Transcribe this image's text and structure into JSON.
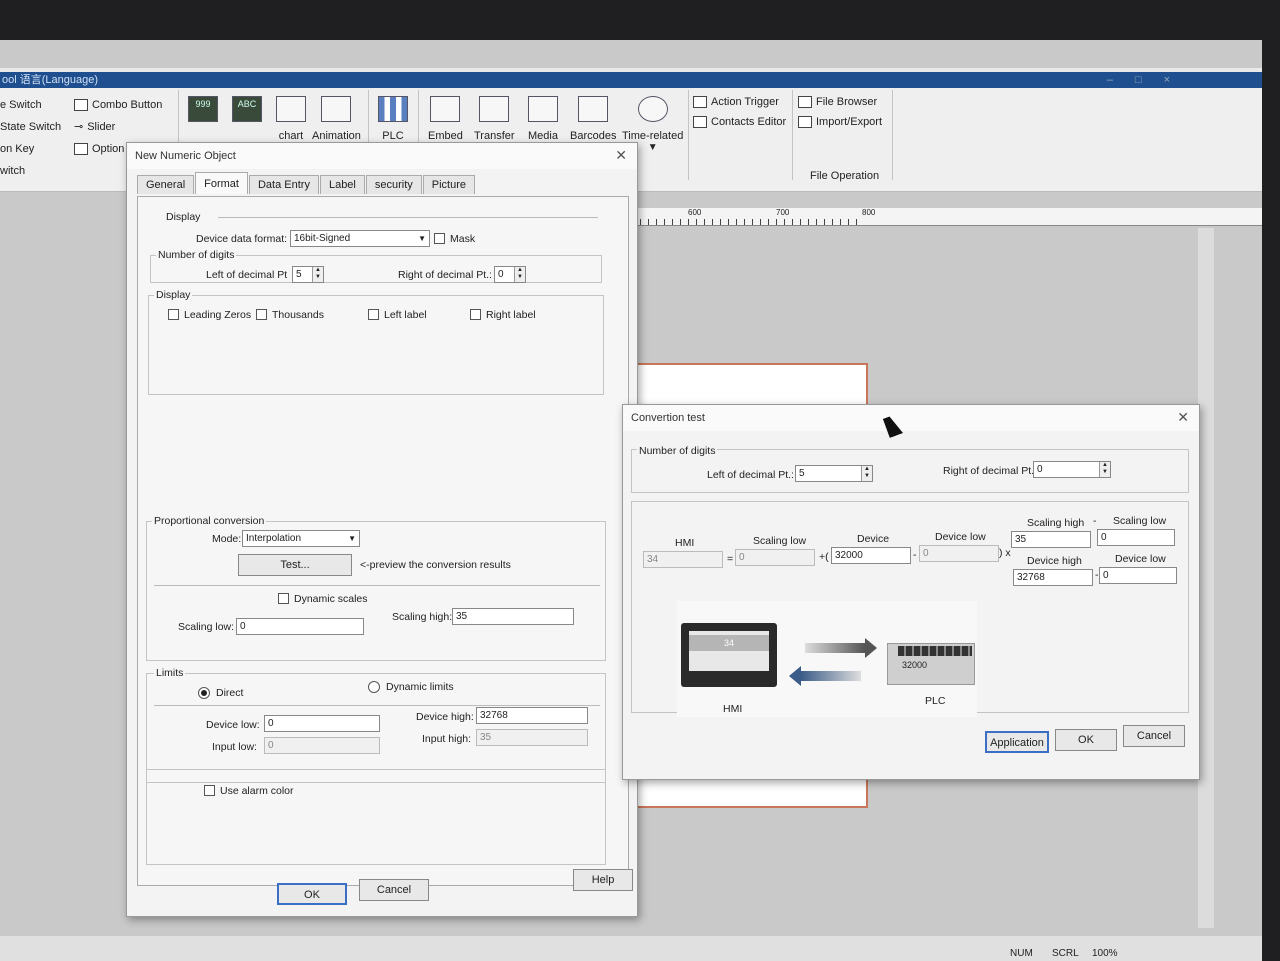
{
  "window": {
    "title": "ool    语言(Language)"
  },
  "ribbon": {
    "left_items": [
      "e Switch",
      "State Switch",
      "on Key",
      "witch"
    ],
    "col2_items": [
      "Combo Button",
      "Slider",
      "Option"
    ],
    "tools": [
      {
        "label": "",
        "icon": "999"
      },
      {
        "label": "",
        "icon": "ABC"
      },
      {
        "label": "chart",
        "icon": "chart-icon"
      },
      {
        "label": "Animation",
        "icon": "animation-icon"
      },
      {
        "label": "PLC",
        "icon": "plc-icon"
      },
      {
        "label": "Embed",
        "icon": "embed-icon"
      },
      {
        "label": "Transfer",
        "icon": "transfer-icon"
      },
      {
        "label": "Media",
        "icon": "media-icon"
      },
      {
        "label": "Barcodes",
        "icon": "qr-icon"
      },
      {
        "label": "Time-related",
        "icon": "timer-icon"
      }
    ],
    "right_items": [
      "Action Trigger",
      "Contacts Editor"
    ],
    "file_items": [
      "File Browser",
      "Import/Export"
    ],
    "file_group_label": "File Operation"
  },
  "ruler": {
    "marks": [
      "600",
      "700",
      "800"
    ]
  },
  "status": {
    "zoom": "100%",
    "scrl": "SCRL",
    "num": "NUM"
  },
  "numeric_dialog": {
    "title": "New Numeric Object",
    "tabs": [
      "General",
      "Format",
      "Data Entry",
      "Label",
      "security",
      "Picture"
    ],
    "active_tab": "Format",
    "display_header": "Display",
    "device_data_format_label": "Device data format:",
    "device_data_format_value": "16bit-Signed",
    "mask_label": "Mask",
    "number_of_digits_label": "Number of digits",
    "left_decimal_label": "Left of decimal Pt",
    "left_decimal_value": "5",
    "right_decimal_label": "Right of decimal Pt.:",
    "right_decimal_value": "0",
    "display_group_label": "Display",
    "leading_zeros": "Leading Zeros",
    "thousands": "Thousands",
    "left_label": "Left label",
    "right_label": "Right label",
    "prop_conversion_label": "Proportional conversion",
    "mode_label": "Mode:",
    "mode_value": "Interpolation",
    "test_button": "Test...",
    "preview_text": "<-preview the conversion results",
    "dynamic_scales": "Dynamic scales",
    "scaling_low_label": "Scaling low:",
    "scaling_low_value": "0",
    "scaling_high_label": "Scaling high:",
    "scaling_high_value": "35",
    "limits_label": "Limits",
    "direct_label": "Direct",
    "dynamic_limits_label": "Dynamic limits",
    "device_low_label": "Device low:",
    "device_low_value": "0",
    "device_high_label": "Device high:",
    "device_high_value": "32768",
    "input_low_label": "Input low:",
    "input_low_value": "0",
    "input_high_label": "Input high:",
    "input_high_value": "35",
    "use_alarm_color": "Use alarm color",
    "ok": "OK",
    "cancel": "Cancel",
    "help": "Help"
  },
  "conversion_dialog": {
    "title": "Convertion test",
    "number_of_digits_label": "Number of digits",
    "left_decimal_label": "Left of decimal Pt.:",
    "left_decimal_value": "5",
    "right_decimal_label": "Right of decimal Pt.:",
    "right_decimal_value": "0",
    "hmi_label": "HMI",
    "hmi_value": "34",
    "eq": "=",
    "scaling_low_label": "Scaling low",
    "scaling_low_value": "0",
    "plus_paren": "+(",
    "device_label": "Device",
    "device_value": "32000",
    "minus": "-",
    "device_low_label": "Device low",
    "device_low_value": "0",
    "close_times": ") x",
    "scaling_high_label": "Scaling high",
    "scaling_high_value": "35",
    "minus2": "-",
    "scaling_low2_label": "Scaling low",
    "scaling_low2_value": "0",
    "device_high_label": "Device high",
    "device_high_value": "32768",
    "minus3": "-",
    "device_low2_label": "Device low",
    "device_low2_value": "0",
    "illus_hmi_value": "34",
    "illus_plc_value": "32000",
    "illus_hmi_caption": "HMI",
    "illus_plc_caption": "PLC",
    "application": "Application",
    "ok": "OK",
    "cancel": "Cancel"
  }
}
